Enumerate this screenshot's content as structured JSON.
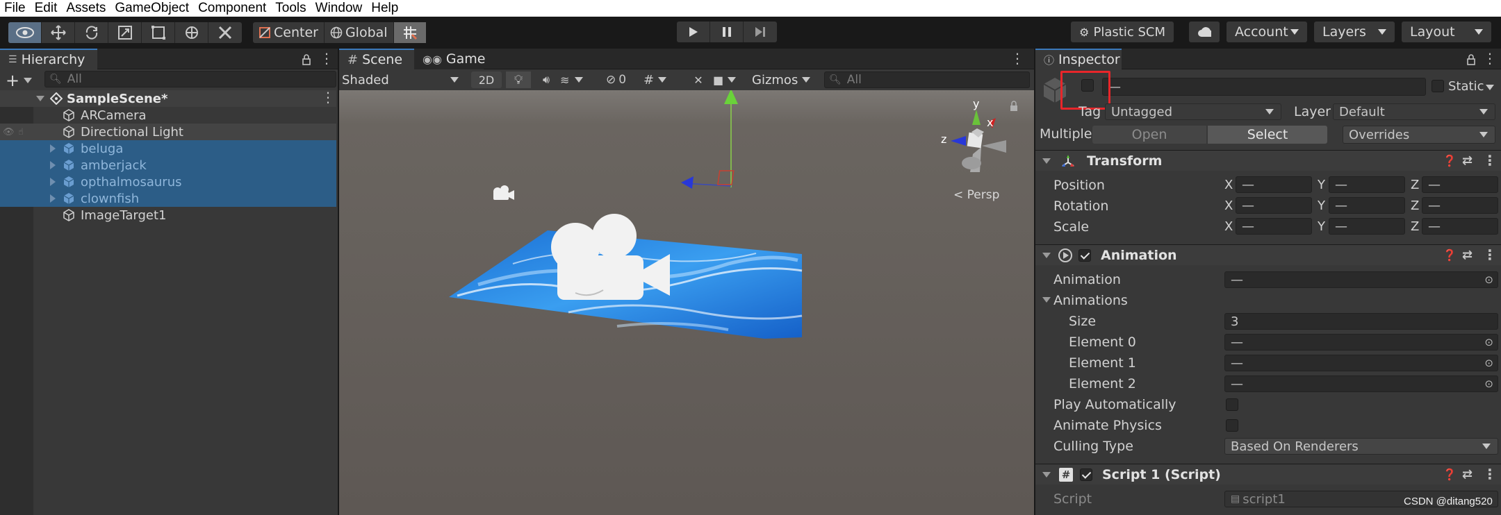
{
  "menu": [
    "File",
    "Edit",
    "Assets",
    "GameObject",
    "Component",
    "Tools",
    "Window",
    "Help"
  ],
  "toolbar": {
    "center_label": "Center",
    "global_label": "Global",
    "plastic_label": "Plastic SCM",
    "account_label": "Account",
    "layers_label": "Layers",
    "layout_label": "Layout"
  },
  "hierarchy": {
    "tab": "Hierarchy",
    "search_placeholder": "All",
    "scene_name": "SampleScene*",
    "items": [
      {
        "label": "ARCamera"
      },
      {
        "label": "Directional Light"
      },
      {
        "label": "beluga"
      },
      {
        "label": "amberjack"
      },
      {
        "label": "opthalmosaurus"
      },
      {
        "label": "clownfish"
      },
      {
        "label": "ImageTarget1"
      }
    ]
  },
  "scene": {
    "tab_scene": "Scene",
    "tab_game": "Game",
    "shading": "Shaded",
    "mode_2d": "2D",
    "hidden_count": "0",
    "gizmos": "Gizmos",
    "search_placeholder": "All",
    "persp": "Persp",
    "axis_y": "y",
    "axis_x": "x",
    "axis_z": "z"
  },
  "inspector": {
    "tab": "Inspector",
    "name_value": "—",
    "static_label": "Static",
    "tag_label": "Tag",
    "tag_value": "Untagged",
    "layer_label": "Layer",
    "layer_value": "Default",
    "multiple_label": "Multiple",
    "open_label": "Open",
    "select_label": "Select",
    "overrides_label": "Overrides",
    "transform": {
      "title": "Transform",
      "position": "Position",
      "rotation": "Rotation",
      "scale": "Scale",
      "x": "X",
      "y": "Y",
      "z": "Z",
      "dash": "—"
    },
    "animation": {
      "title": "Animation",
      "animation_label": "Animation",
      "animation_value": "—",
      "animations_label": "Animations",
      "size_label": "Size",
      "size_value": "3",
      "elements": [
        {
          "label": "Element 0",
          "value": "—"
        },
        {
          "label": "Element 1",
          "value": "—"
        },
        {
          "label": "Element 2",
          "value": "—"
        }
      ],
      "play_auto": "Play Automatically",
      "animate_physics": "Animate Physics",
      "culling_label": "Culling Type",
      "culling_value": "Based On Renderers"
    },
    "script": {
      "title": "Script 1 (Script)",
      "script_label": "Script",
      "script_value": "script1"
    }
  },
  "watermark": "CSDN @ditang520",
  "colors": {
    "accent_red": "#e8262a",
    "selection": "#2c5d87",
    "panel": "#383838"
  }
}
